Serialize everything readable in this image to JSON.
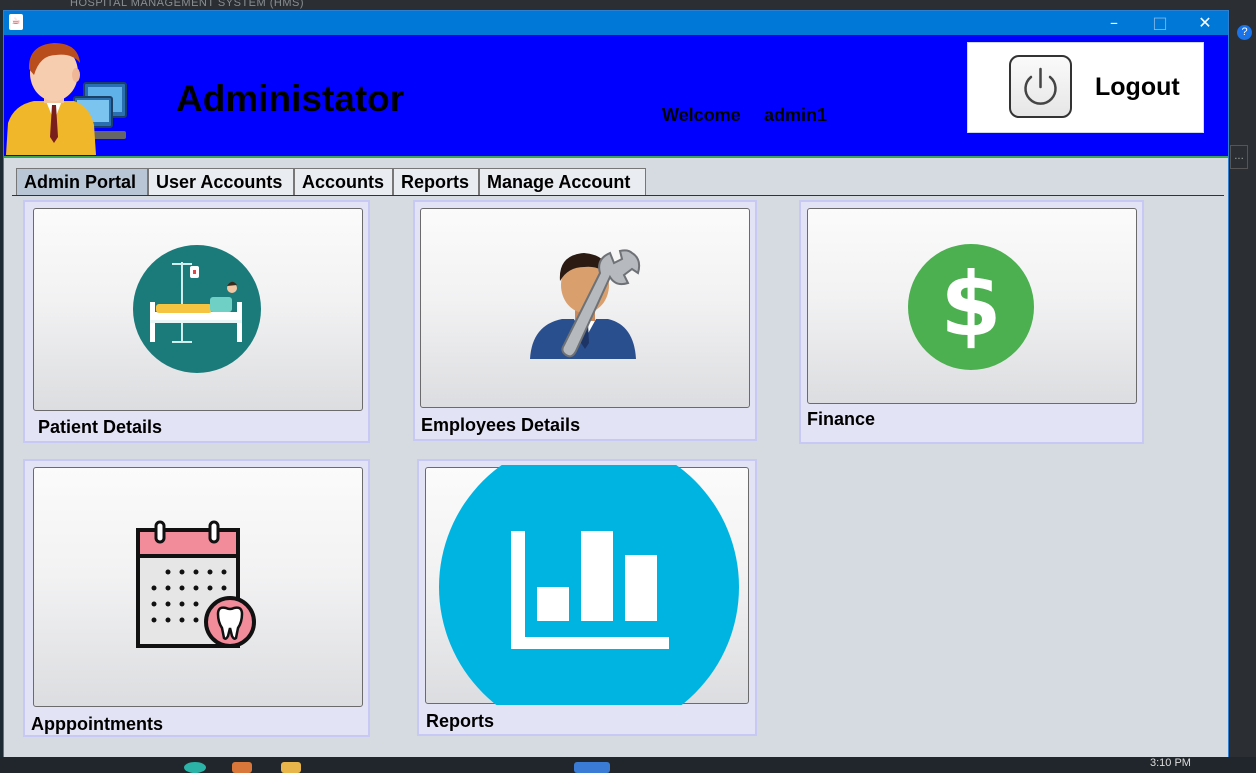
{
  "desktop": {
    "background_title": "HOSPITAL MANAGEMENT SYSTEM (HMS)",
    "help_glyph": "?",
    "side_box_text": "...",
    "clock": "3:10 PM"
  },
  "window": {
    "minimize_glyph": "–",
    "maximize_glyph": "□",
    "close_glyph": "✕"
  },
  "header": {
    "title": "Administator",
    "welcome_label": "Welcome",
    "username": "admin1",
    "logout_label": "Logout",
    "background_color": "#0000ff"
  },
  "tabs": [
    {
      "label": "Admin Portal",
      "active": true
    },
    {
      "label": "User Accounts",
      "active": false
    },
    {
      "label": "Accounts",
      "active": false
    },
    {
      "label": "Reports",
      "active": false
    },
    {
      "label": "Manage Account",
      "active": false
    }
  ],
  "tiles": {
    "patient": {
      "label": "Patient Details",
      "icon": "hospital-bed-icon"
    },
    "employees": {
      "label": "Employees Details",
      "icon": "employee-wrench-icon"
    },
    "finance": {
      "label": "Finance",
      "icon": "dollar-icon"
    },
    "appointments": {
      "label": "Apppointments",
      "icon": "calendar-tooth-icon"
    },
    "reports": {
      "label": "Reports",
      "icon": "bar-chart-icon"
    }
  },
  "colors": {
    "title_bar": "#0078d7",
    "tile_border": "#c7c9f4",
    "finance_green": "#4caf50",
    "reports_blue": "#00b4e2",
    "patient_teal": "#1b7b7b"
  }
}
